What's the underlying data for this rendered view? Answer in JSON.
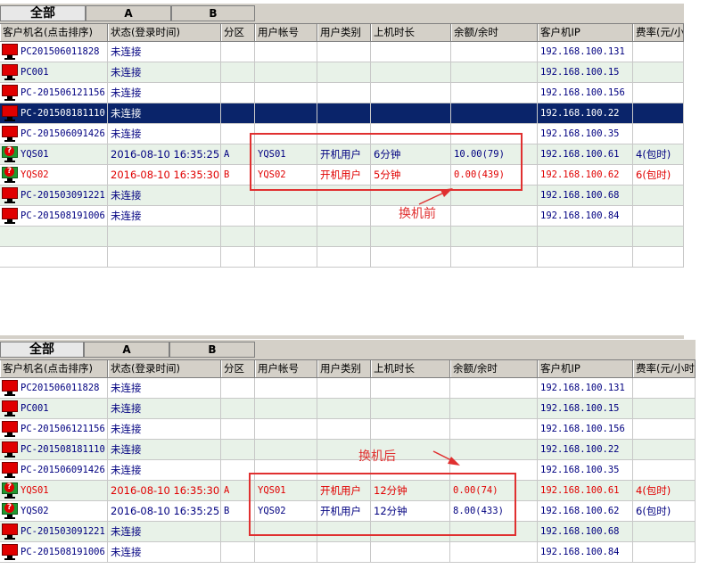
{
  "tabs": [
    "全部",
    "A",
    "B"
  ],
  "columns": [
    "客户机名(点击排序)",
    "状态(登录时间)",
    "分区",
    "用户帐号",
    "用户类别",
    "上机时长",
    "余额/余时",
    "客户机IP",
    "费率(元/小时)"
  ],
  "top": {
    "annotation": "换机前",
    "rows": [
      {
        "name": "PC201506011828",
        "status": "未连接",
        "zone": "",
        "account": "",
        "type": "",
        "duration": "",
        "balance": "",
        "ip": "192.168.100.131",
        "rate": ""
      },
      {
        "name": "PC001",
        "status": "未连接",
        "zone": "",
        "account": "",
        "type": "",
        "duration": "",
        "balance": "",
        "ip": "192.168.100.15",
        "rate": ""
      },
      {
        "name": "PC-201506121156",
        "status": "未连接",
        "zone": "",
        "account": "",
        "type": "",
        "duration": "",
        "balance": "",
        "ip": "192.168.100.156",
        "rate": ""
      },
      {
        "name": "PC-201508181110",
        "status": "未连接",
        "zone": "",
        "account": "",
        "type": "",
        "duration": "",
        "balance": "",
        "ip": "192.168.100.22",
        "rate": "",
        "selected": true
      },
      {
        "name": "PC-201506091426",
        "status": "未连接",
        "zone": "",
        "account": "",
        "type": "",
        "duration": "",
        "balance": "",
        "ip": "192.168.100.35",
        "rate": ""
      },
      {
        "name": "YQS01",
        "status": "2016-08-10 16:35:25",
        "zone": "A",
        "account": "YQS01",
        "type": "开机用户",
        "duration": "6分钟",
        "balance": "10.00(79)",
        "ip": "192.168.100.61",
        "rate": "4(包时)",
        "online": true,
        "color": "blue"
      },
      {
        "name": "YQS02",
        "status": "2016-08-10 16:35:30",
        "zone": "B",
        "account": "YQS02",
        "type": "开机用户",
        "duration": "5分钟",
        "balance": "0.00(439)",
        "ip": "192.168.100.62",
        "rate": "6(包时)",
        "online": true,
        "color": "red"
      },
      {
        "name": "PC-201503091221",
        "status": "未连接",
        "zone": "",
        "account": "",
        "type": "",
        "duration": "",
        "balance": "",
        "ip": "192.168.100.68",
        "rate": ""
      },
      {
        "name": "PC-201508191006",
        "status": "未连接",
        "zone": "",
        "account": "",
        "type": "",
        "duration": "",
        "balance": "",
        "ip": "192.168.100.84",
        "rate": ""
      },
      {
        "empty": true
      },
      {
        "empty": true
      }
    ]
  },
  "bottom": {
    "annotation": "换机后",
    "rows": [
      {
        "name": "PC201506011828",
        "status": "未连接",
        "zone": "",
        "account": "",
        "type": "",
        "duration": "",
        "balance": "",
        "ip": "192.168.100.131",
        "rate": ""
      },
      {
        "name": "PC001",
        "status": "未连接",
        "zone": "",
        "account": "",
        "type": "",
        "duration": "",
        "balance": "",
        "ip": "192.168.100.15",
        "rate": ""
      },
      {
        "name": "PC-201506121156",
        "status": "未连接",
        "zone": "",
        "account": "",
        "type": "",
        "duration": "",
        "balance": "",
        "ip": "192.168.100.156",
        "rate": ""
      },
      {
        "name": "PC-201508181110",
        "status": "未连接",
        "zone": "",
        "account": "",
        "type": "",
        "duration": "",
        "balance": "",
        "ip": "192.168.100.22",
        "rate": ""
      },
      {
        "name": "PC-201506091426",
        "status": "未连接",
        "zone": "",
        "account": "",
        "type": "",
        "duration": "",
        "balance": "",
        "ip": "192.168.100.35",
        "rate": ""
      },
      {
        "name": "YQS01",
        "status": "2016-08-10 16:35:30",
        "zone": "A",
        "account": "YQS01",
        "type": "开机用户",
        "duration": "12分钟",
        "balance": "0.00(74)",
        "ip": "192.168.100.61",
        "rate": "4(包时)",
        "online": true,
        "color": "red"
      },
      {
        "name": "YQS02",
        "status": "2016-08-10 16:35:25",
        "zone": "B",
        "account": "YQS02",
        "type": "开机用户",
        "duration": "12分钟",
        "balance": "8.00(433)",
        "ip": "192.168.100.62",
        "rate": "6(包时)",
        "online": true,
        "color": "blue"
      },
      {
        "name": "PC-201503091221",
        "status": "未连接",
        "zone": "",
        "account": "",
        "type": "",
        "duration": "",
        "balance": "",
        "ip": "192.168.100.68",
        "rate": ""
      },
      {
        "name": "PC-201508191006",
        "status": "未连接",
        "zone": "",
        "account": "",
        "type": "",
        "duration": "",
        "balance": "",
        "ip": "192.168.100.84",
        "rate": ""
      }
    ]
  },
  "colors": {
    "selected": "#0a246a",
    "highlight": "#e03030",
    "even_row": "#e8f2e8"
  }
}
